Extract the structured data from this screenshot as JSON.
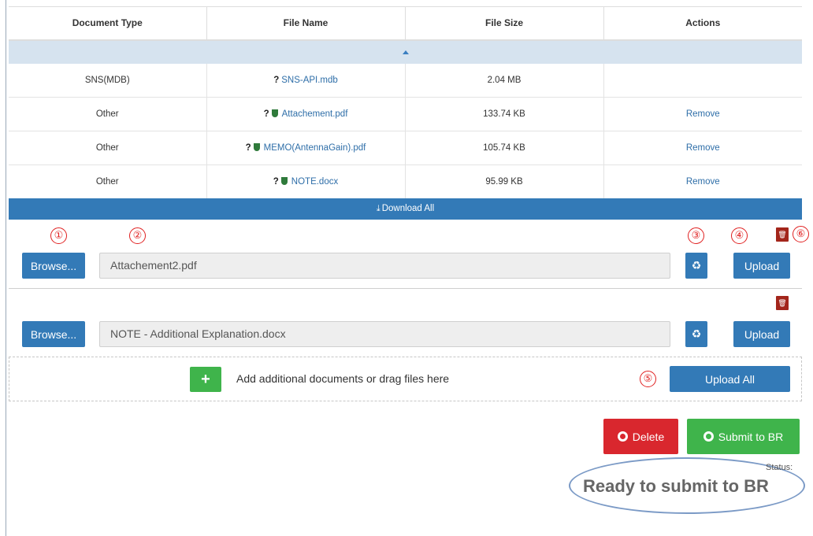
{
  "table": {
    "headers": [
      "Document Type",
      "File Name",
      "File Size",
      "Actions"
    ],
    "rows": [
      {
        "type": "SNS(MDB)",
        "file": "SNS-API.mdb",
        "size": "2.04 MB",
        "action": ""
      },
      {
        "type": "Other",
        "file": "Attachement.pdf",
        "size": "133.74 KB",
        "action": "Remove"
      },
      {
        "type": "Other",
        "file": "MEMO(AntennaGain).pdf",
        "size": "105.74 KB",
        "action": "Remove"
      },
      {
        "type": "Other",
        "file": "NOTE.docx",
        "size": "95.99 KB",
        "action": "Remove"
      }
    ],
    "unknown_mark": "?",
    "download_all_label": "Download All"
  },
  "uploads": [
    {
      "browse_label": "Browse...",
      "file_value": "Attachement2.pdf",
      "upload_label": "Upload"
    },
    {
      "browse_label": "Browse...",
      "file_value": "NOTE - Additional Explanation.docx",
      "upload_label": "Upload"
    }
  ],
  "dropzone": {
    "plus_label": "+",
    "text": "Add additional documents or drag files here",
    "upload_all_label": "Upload All"
  },
  "actions": {
    "delete_label": "Delete",
    "submit_label": "Submit to BR"
  },
  "status": {
    "label": "Status:",
    "value": "Ready to submit to BR"
  },
  "markers": [
    "①",
    "②",
    "③",
    "④",
    "⑤",
    "⑥"
  ],
  "icons": {
    "recycle": "recycle-icon",
    "trash": "trash-icon",
    "shield": "shield-icon",
    "download": "download-icon",
    "globe": "globe-icon",
    "caret": "caret-up-icon"
  },
  "colors": {
    "primary": "#337ab7",
    "success": "#3fb44b",
    "danger": "#d9272e",
    "trash": "#a3251b",
    "marker": "#e02020"
  }
}
